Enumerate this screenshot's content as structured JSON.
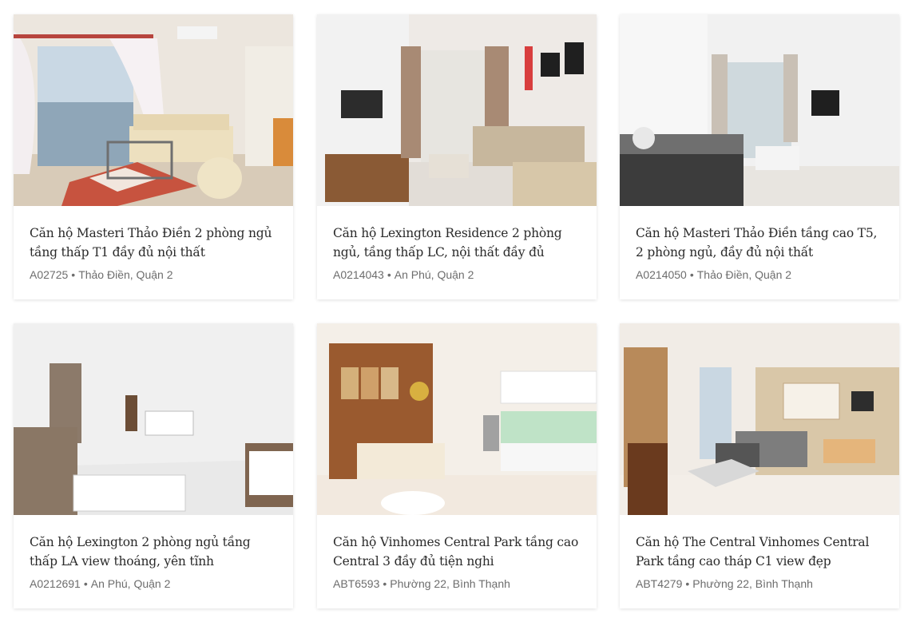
{
  "listings": [
    {
      "title": "Căn hộ Masteri Thảo Điền 2 phòng ngủ tầng thấp T1 đầy đủ nội thất",
      "code": "A02725",
      "area": "Thảo Điền, Quận 2"
    },
    {
      "title": "Căn hộ Lexington Residence 2 phòng ngủ, tầng thấp LC, nội thất đầy đủ",
      "code": "A0214043",
      "area": "An Phú, Quận 2"
    },
    {
      "title": "Căn hộ Masteri Thảo Điền tầng cao T5, 2 phòng ngủ, đầy đủ nội thất",
      "code": "A0214050",
      "area": "Thảo Điền, Quận 2"
    },
    {
      "title": "Căn hộ Lexington 2 phòng ngủ tầng thấp LA view thoáng, yên tĩnh",
      "code": "A0212691",
      "area": "An Phú, Quận 2"
    },
    {
      "title": "Căn hộ Vinhomes Central Park tầng cao Central 3 đầy đủ tiện nghi",
      "code": "ABT6593",
      "area": "Phường 22, Bình Thạnh"
    },
    {
      "title": "Căn hộ The Central Vinhomes Central Park tầng cao tháp C1 view đẹp",
      "code": "ABT4279",
      "area": "Phường 22, Bình Thạnh"
    }
  ],
  "separator": "•"
}
